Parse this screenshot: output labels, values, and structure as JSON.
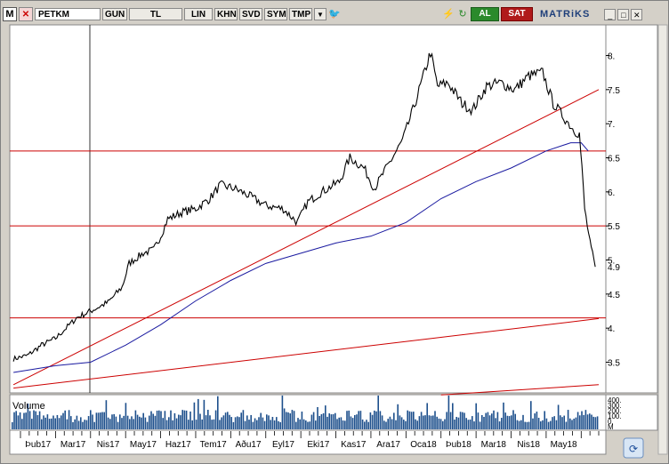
{
  "toolbar": {
    "logo_label": "M",
    "symbol": "PETKM",
    "period_button": "GUN",
    "currency_button": "TL",
    "scale_button": "LIN",
    "buttons": [
      "KHN",
      "SVD",
      "SYM",
      "TMP"
    ],
    "buy_button": "AL",
    "sell_button": "SAT",
    "brand": "MATRiKS"
  },
  "colors": {
    "price": "#000000",
    "moving_average": "#1a1aa0",
    "trendlines": "#cc0000",
    "volume": "#1d4f8c",
    "background": "#ffffff"
  },
  "chart_data": [
    {
      "type": "line",
      "name": "price",
      "y_axis_side": "right",
      "ylim": [
        3.05,
        8.45
      ],
      "yticks": [
        "8.",
        "7.5",
        "7.",
        "6.5",
        "6.",
        "5.5",
        "5.",
        "4.5",
        "4.",
        "3.5"
      ],
      "ytick_values": [
        8.0,
        7.5,
        7.0,
        6.5,
        6.0,
        5.5,
        5.0,
        4.5,
        4.0,
        3.5
      ],
      "last_value_label": "4.9",
      "last_value": 4.9,
      "x_labels": [
        "Þub17",
        "Mar17",
        "Nis17",
        "May17",
        "Haz17",
        "Tem17",
        "Aðu17",
        "Eyl17",
        "Eki17",
        "Kas17",
        "Ara17",
        "Oca18",
        "Þub18",
        "Mar18",
        "Nis18",
        "May18"
      ],
      "x_range_months": [
        0,
        16.5
      ],
      "price_series": [
        [
          -0.2,
          3.55
        ],
        [
          0.2,
          3.6
        ],
        [
          0.6,
          3.75
        ],
        [
          1.0,
          3.85
        ],
        [
          1.3,
          4.0
        ],
        [
          1.6,
          4.15
        ],
        [
          2.0,
          4.25
        ],
        [
          2.5,
          4.38
        ],
        [
          2.9,
          4.6
        ],
        [
          3.1,
          4.95
        ],
        [
          3.5,
          5.1
        ],
        [
          3.8,
          5.15
        ],
        [
          4.0,
          5.35
        ],
        [
          4.2,
          5.6
        ],
        [
          4.6,
          5.7
        ],
        [
          5.0,
          5.75
        ],
        [
          5.4,
          5.9
        ],
        [
          5.7,
          6.1
        ],
        [
          6.1,
          6.05
        ],
        [
          6.5,
          5.95
        ],
        [
          7.0,
          5.8
        ],
        [
          7.5,
          5.75
        ],
        [
          7.9,
          5.55
        ],
        [
          8.2,
          5.85
        ],
        [
          8.6,
          6.0
        ],
        [
          9.1,
          6.15
        ],
        [
          9.4,
          6.5
        ],
        [
          9.8,
          6.35
        ],
        [
          10.1,
          6.05
        ],
        [
          10.5,
          6.4
        ],
        [
          10.9,
          6.75
        ],
        [
          11.2,
          7.2
        ],
        [
          11.5,
          7.7
        ],
        [
          11.7,
          8.05
        ],
        [
          11.9,
          7.55
        ],
        [
          12.2,
          7.6
        ],
        [
          12.6,
          7.3
        ],
        [
          12.9,
          7.2
        ],
        [
          13.3,
          7.55
        ],
        [
          13.7,
          7.6
        ],
        [
          14.1,
          7.5
        ],
        [
          14.5,
          7.7
        ],
        [
          14.9,
          7.75
        ],
        [
          15.2,
          7.3
        ],
        [
          15.5,
          7.1
        ],
        [
          15.8,
          6.9
        ],
        [
          15.95,
          6.85
        ],
        [
          16.02,
          6.35
        ],
        [
          16.1,
          5.75
        ],
        [
          16.25,
          5.25
        ],
        [
          16.4,
          4.9
        ]
      ],
      "moving_average": [
        [
          -0.2,
          3.35
        ],
        [
          1.0,
          3.45
        ],
        [
          2.0,
          3.5
        ],
        [
          3.0,
          3.75
        ],
        [
          4.0,
          4.05
        ],
        [
          5.0,
          4.4
        ],
        [
          6.0,
          4.7
        ],
        [
          7.0,
          4.95
        ],
        [
          8.0,
          5.1
        ],
        [
          9.0,
          5.25
        ],
        [
          10.0,
          5.35
        ],
        [
          11.0,
          5.55
        ],
        [
          12.0,
          5.9
        ],
        [
          13.0,
          6.15
        ],
        [
          14.0,
          6.35
        ],
        [
          15.0,
          6.6
        ],
        [
          15.7,
          6.72
        ],
        [
          16.0,
          6.72
        ],
        [
          16.2,
          6.6
        ]
      ],
      "horizontal_levels": [
        6.6,
        5.5,
        4.15
      ],
      "trendlines": [
        [
          [
            -0.2,
            3.17
          ],
          [
            16.5,
            7.5
          ]
        ],
        [
          [
            -0.2,
            3.12
          ],
          [
            16.5,
            4.14
          ]
        ],
        [
          [
            12.0,
            3.02
          ],
          [
            16.5,
            3.17
          ]
        ]
      ]
    },
    {
      "type": "bar",
      "name": "Volume",
      "title": "Volume",
      "axis_labels": [
        "400.",
        "300.",
        "200.",
        "100.",
        "0.",
        "M"
      ],
      "color": "#1d4f8c"
    }
  ]
}
